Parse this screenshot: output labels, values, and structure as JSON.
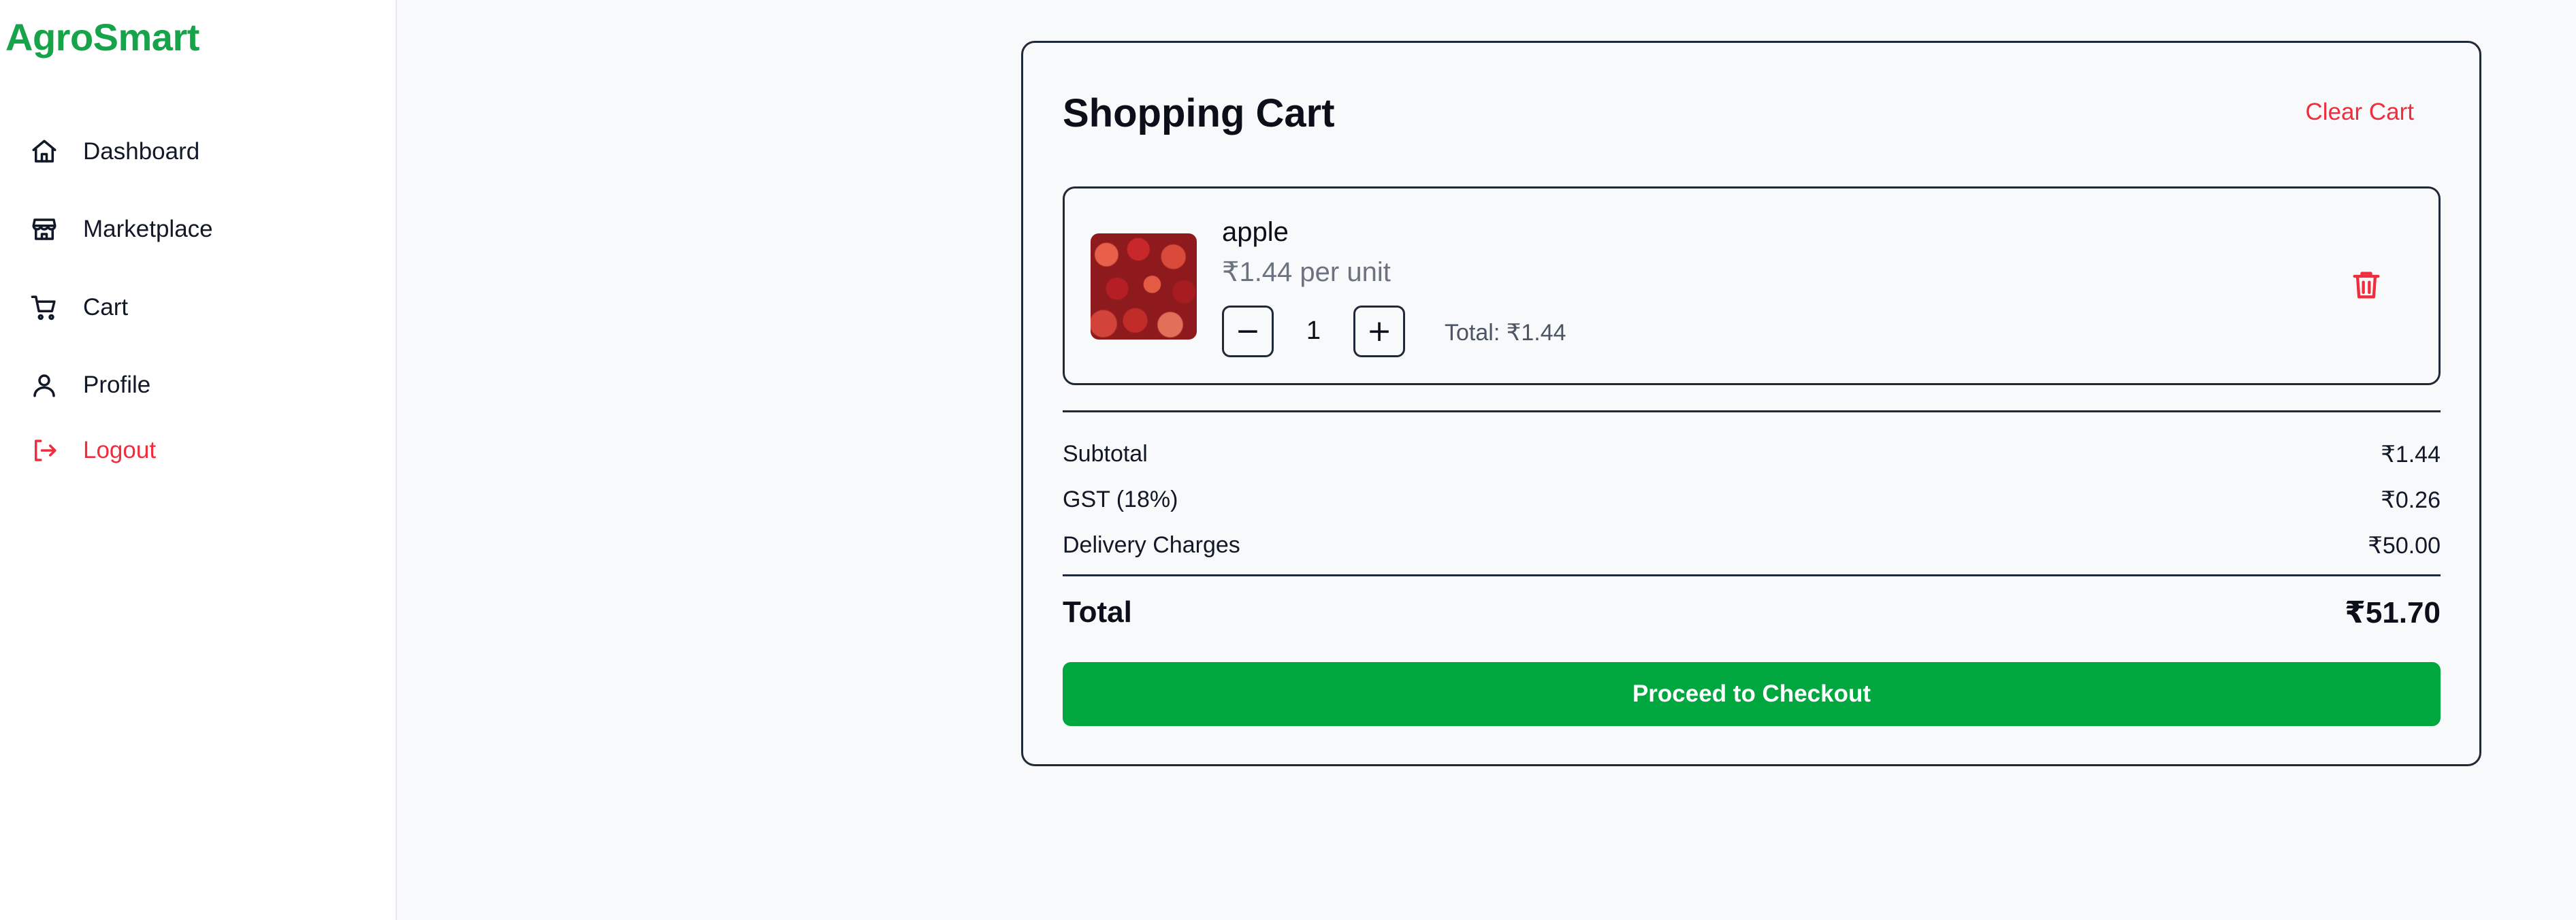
{
  "brand": {
    "name": "AgroSmart"
  },
  "sidebar": {
    "items": [
      {
        "label": "Dashboard",
        "icon": "home-icon"
      },
      {
        "label": "Marketplace",
        "icon": "store-icon"
      },
      {
        "label": "Cart",
        "icon": "cart-icon"
      },
      {
        "label": "Profile",
        "icon": "user-icon"
      },
      {
        "label": "Logout",
        "icon": "logout-icon"
      }
    ]
  },
  "cart": {
    "title": "Shopping Cart",
    "clear_label": "Clear Cart",
    "items": [
      {
        "name": "apple",
        "price_text": "₹1.44 per unit",
        "quantity": "1",
        "decrement_symbol": "−",
        "increment_symbol": "+",
        "total_text": "Total: ₹1.44"
      }
    ],
    "summary": {
      "subtotal_label": "Subtotal",
      "subtotal_value": "₹1.44",
      "gst_label": "GST (18%)",
      "gst_value": "₹0.26",
      "delivery_label": "Delivery Charges",
      "delivery_value": "₹50.00",
      "total_label": "Total",
      "total_value": "₹51.70"
    },
    "checkout_label": "Proceed to Checkout"
  },
  "colors": {
    "brand": "#16a34a",
    "danger": "#ef2d3d",
    "checkout": "#00a63e"
  }
}
